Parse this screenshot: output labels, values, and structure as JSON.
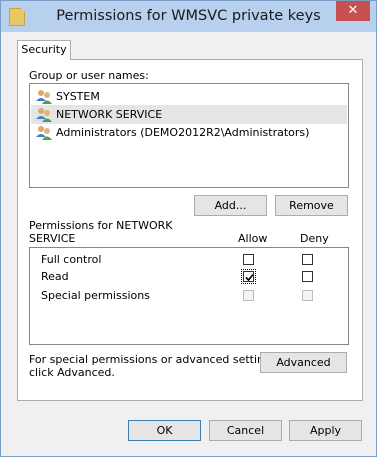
{
  "window": {
    "title": "Permissions for WMSVC private keys",
    "close_glyph": "✕"
  },
  "tabs": [
    {
      "label": "Security",
      "active": true
    }
  ],
  "group_label": "Group or user names:",
  "users": [
    {
      "name": "SYSTEM",
      "icon": "user-group-icon",
      "selected": false
    },
    {
      "name": "NETWORK SERVICE",
      "icon": "user-group-icon",
      "selected": true
    },
    {
      "name": "Administrators (DEMO2012R2\\Administrators)",
      "icon": "user-group-icon",
      "selected": false
    }
  ],
  "buttons": {
    "add": "Add...",
    "remove": "Remove",
    "advanced": "Advanced",
    "ok": "OK",
    "cancel": "Cancel",
    "apply": "Apply"
  },
  "permissions_label_line1": "Permissions for NETWORK",
  "permissions_label_line2": "SERVICE",
  "columns": {
    "allow": "Allow",
    "deny": "Deny"
  },
  "permissions": [
    {
      "name": "Full control",
      "allow": false,
      "deny": false,
      "disabled": false
    },
    {
      "name": "Read",
      "allow": true,
      "deny": false,
      "disabled": false
    },
    {
      "name": "Special permissions",
      "allow": false,
      "deny": false,
      "disabled": true
    }
  ],
  "advanced_text_line1": "For special permissions or advanced settings,",
  "advanced_text_line2": "click Advanced.",
  "colors": {
    "titlebar": "#b6d0ee",
    "close": "#c75050",
    "selected_row": "#e5e5e5"
  }
}
